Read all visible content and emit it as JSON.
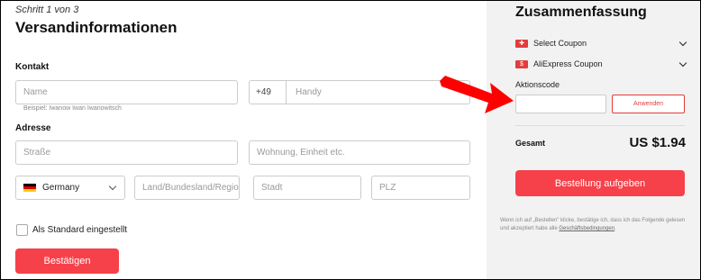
{
  "shipping": {
    "step": "Schritt 1 von 3",
    "title": "Versandinformationen",
    "contact_label": "Kontakt",
    "name_placeholder": "Name",
    "name_hint": "Beispiel: Iwanow Iwan Iwanowitsch",
    "phone_code": "+49",
    "phone_placeholder": "Handy",
    "address_label": "Adresse",
    "street_placeholder": "Straße",
    "apartment_placeholder": "Wohnung, Einheit etc.",
    "country": "Germany",
    "state_placeholder": "Land/Bundesland/Regio",
    "city_placeholder": "Stadt",
    "zip_placeholder": "PLZ",
    "default_label": "Als Standard eingestellt",
    "confirm_button": "Bestätigen"
  },
  "summary": {
    "title": "Zusammenfassung",
    "select_coupon": "Select Coupon",
    "aliexpress_coupon": "AliExpress Coupon",
    "promo_label": "Aktionscode",
    "apply_button": "Anwenden",
    "total_label": "Gesamt",
    "total_value": "US $1.94",
    "order_button": "Bestellung aufgeben",
    "terms_text": "Wenn ich auf „Bestellen\" klicke, bestätige ich, dass ich das Folgende gelesen und akzeptiert habe alle ",
    "terms_link": "Geschäftsbedingungen",
    "terms_end": "."
  },
  "colors": {
    "accent": "#f6414a",
    "arrow": "#ff0000"
  },
  "icons": {
    "coupon": "coupon-icon",
    "chevron": "chevron-down-icon",
    "flag": "flag-de-icon"
  }
}
